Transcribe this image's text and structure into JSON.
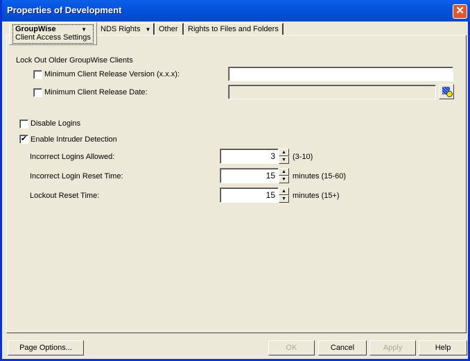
{
  "window": {
    "title": "Properties of Development"
  },
  "tabs": [
    {
      "label": "GroupWise",
      "sublabel": "Client Access Settings",
      "selected": true,
      "dropdown": true
    },
    {
      "label": "NDS Rights",
      "dropdown": true
    },
    {
      "label": "Other"
    },
    {
      "label": "Rights to Files and Folders"
    }
  ],
  "lockout": {
    "heading": "Lock Out Older GroupWise Clients",
    "min_version_label": "Minimum Client Release Version (x.x.x):",
    "min_version_checked": false,
    "min_version_value": "",
    "min_date_label": "Minimum Client Release Date:",
    "min_date_checked": false,
    "min_date_value": ""
  },
  "disable_logins": {
    "label": "Disable Logins",
    "checked": false
  },
  "intruder": {
    "label": "Enable Intruder Detection",
    "checked": true,
    "incorrect_logins": {
      "label": "Incorrect Logins Allowed:",
      "value": "3",
      "hint": "(3-10)"
    },
    "reset_time": {
      "label": "Incorrect Login Reset Time:",
      "value": "15",
      "hint": "minutes (15-60)"
    },
    "lockout_time": {
      "label": "Lockout Reset Time:",
      "value": "15",
      "hint": "minutes (15+)"
    }
  },
  "buttons": {
    "page_options": "Page Options...",
    "ok": "OK",
    "cancel": "Cancel",
    "apply": "Apply",
    "help": "Help"
  },
  "check_mark": "✔"
}
